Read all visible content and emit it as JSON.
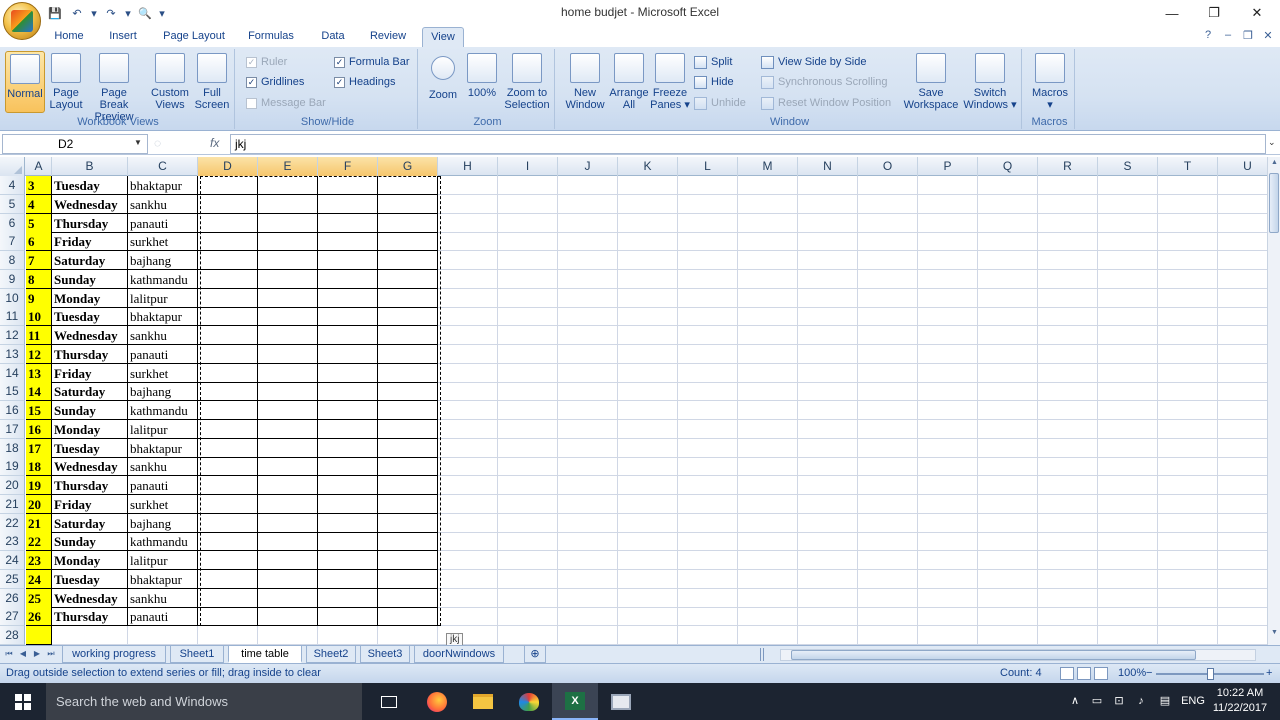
{
  "window": {
    "title": "home budjet - Microsoft Excel",
    "minimize": "—",
    "restore": "❐",
    "close": "✕"
  },
  "qat": [
    "💾",
    "↶",
    "▾",
    "↷",
    "▾",
    "🔍",
    "▾"
  ],
  "tabs": [
    "Home",
    "Insert",
    "Page Layout",
    "Formulas",
    "Data",
    "Review",
    "View"
  ],
  "active_tab": "View",
  "ribbon": {
    "workbook_views": {
      "label": "Workbook Views",
      "normal": "Normal",
      "page_layout_1": "Page",
      "page_layout_2": "Layout",
      "page_break_1": "Page Break",
      "page_break_2": "Preview",
      "custom_views_1": "Custom",
      "custom_views_2": "Views",
      "full_screen_1": "Full",
      "full_screen_2": "Screen"
    },
    "show_hide": {
      "label": "Show/Hide",
      "ruler": "Ruler",
      "gridlines": "Gridlines",
      "message_bar": "Message Bar",
      "formula_bar": "Formula Bar",
      "headings": "Headings"
    },
    "zoom": {
      "label": "Zoom",
      "zoom": "Zoom",
      "hundred": "100%",
      "zoom_sel_1": "Zoom to",
      "zoom_sel_2": "Selection"
    },
    "window": {
      "label": "Window",
      "new_window_1": "New",
      "new_window_2": "Window",
      "arrange_1": "Arrange",
      "arrange_2": "All",
      "freeze_1": "Freeze",
      "freeze_2": "Panes ▾",
      "split": "Split",
      "hide": "Hide",
      "unhide": "Unhide",
      "side_by_side": "View Side by Side",
      "sync_scroll": "Synchronous Scrolling",
      "reset_pos": "Reset Window Position",
      "save_ws_1": "Save",
      "save_ws_2": "Workspace",
      "switch_1": "Switch",
      "switch_2": "Windows ▾"
    },
    "macros": {
      "label": "Macros",
      "macros": "Macros",
      "arrow": "▾"
    }
  },
  "formula": {
    "name_box": "D2",
    "fx": "fx",
    "value": "jkj"
  },
  "columns": [
    "A",
    "B",
    "C",
    "D",
    "E",
    "F",
    "G",
    "H",
    "I",
    "J",
    "K",
    "L",
    "M",
    "N",
    "O",
    "P",
    "Q",
    "R",
    "S",
    "T",
    "U"
  ],
  "rows": [
    {
      "r": "4",
      "a": "3",
      "b": "Tuesday",
      "c": "bhaktapur"
    },
    {
      "r": "5",
      "a": "4",
      "b": "Wednesday",
      "c": "sankhu"
    },
    {
      "r": "6",
      "a": "5",
      "b": "Thursday",
      "c": "panauti"
    },
    {
      "r": "7",
      "a": "6",
      "b": "Friday",
      "c": "surkhet"
    },
    {
      "r": "8",
      "a": "7",
      "b": "Saturday",
      "c": "bajhang"
    },
    {
      "r": "9",
      "a": "8",
      "b": "Sunday",
      "c": "kathmandu"
    },
    {
      "r": "10",
      "a": "9",
      "b": "Monday",
      "c": "lalitpur"
    },
    {
      "r": "11",
      "a": "10",
      "b": "Tuesday",
      "c": "bhaktapur"
    },
    {
      "r": "12",
      "a": "11",
      "b": "Wednesday",
      "c": "sankhu"
    },
    {
      "r": "13",
      "a": "12",
      "b": "Thursday",
      "c": "panauti"
    },
    {
      "r": "14",
      "a": "13",
      "b": "Friday",
      "c": "surkhet"
    },
    {
      "r": "15",
      "a": "14",
      "b": "Saturday",
      "c": "bajhang"
    },
    {
      "r": "16",
      "a": "15",
      "b": "Sunday",
      "c": "kathmandu"
    },
    {
      "r": "17",
      "a": "16",
      "b": "Monday",
      "c": "lalitpur"
    },
    {
      "r": "18",
      "a": "17",
      "b": "Tuesday",
      "c": "bhaktapur"
    },
    {
      "r": "19",
      "a": "18",
      "b": "Wednesday",
      "c": "sankhu"
    },
    {
      "r": "20",
      "a": "19",
      "b": "Thursday",
      "c": "panauti"
    },
    {
      "r": "21",
      "a": "20",
      "b": "Friday",
      "c": "surkhet"
    },
    {
      "r": "22",
      "a": "21",
      "b": "Saturday",
      "c": "bajhang"
    },
    {
      "r": "23",
      "a": "22",
      "b": "Sunday",
      "c": "kathmandu"
    },
    {
      "r": "24",
      "a": "23",
      "b": "Monday",
      "c": "lalitpur"
    },
    {
      "r": "25",
      "a": "24",
      "b": "Tuesday",
      "c": "bhaktapur"
    },
    {
      "r": "26",
      "a": "25",
      "b": "Wednesday",
      "c": "sankhu"
    },
    {
      "r": "27",
      "a": "26",
      "b": "Thursday",
      "c": "panauti"
    },
    {
      "r": "28",
      "a": "",
      "b": "",
      "c": ""
    }
  ],
  "fill_tooltip": "jkj",
  "sheets": [
    "working progress",
    "Sheet1",
    "time table",
    "Sheet2",
    "Sheet3",
    "doorNwindows"
  ],
  "active_sheet": "time table",
  "status": {
    "message": "Drag outside selection to extend series or fill; drag inside to clear",
    "count": "Count: 4",
    "zoom": "100%"
  },
  "taskbar": {
    "search": "Search the web and Windows",
    "lang": "ENG",
    "time": "10:22 AM",
    "date": "11/22/2017"
  },
  "colors": {
    "ribbon_bg": "#dfe9f5",
    "selected_header": "#f6c66c",
    "number_fill": "#ffff00",
    "taskbar": "#1c2431"
  }
}
